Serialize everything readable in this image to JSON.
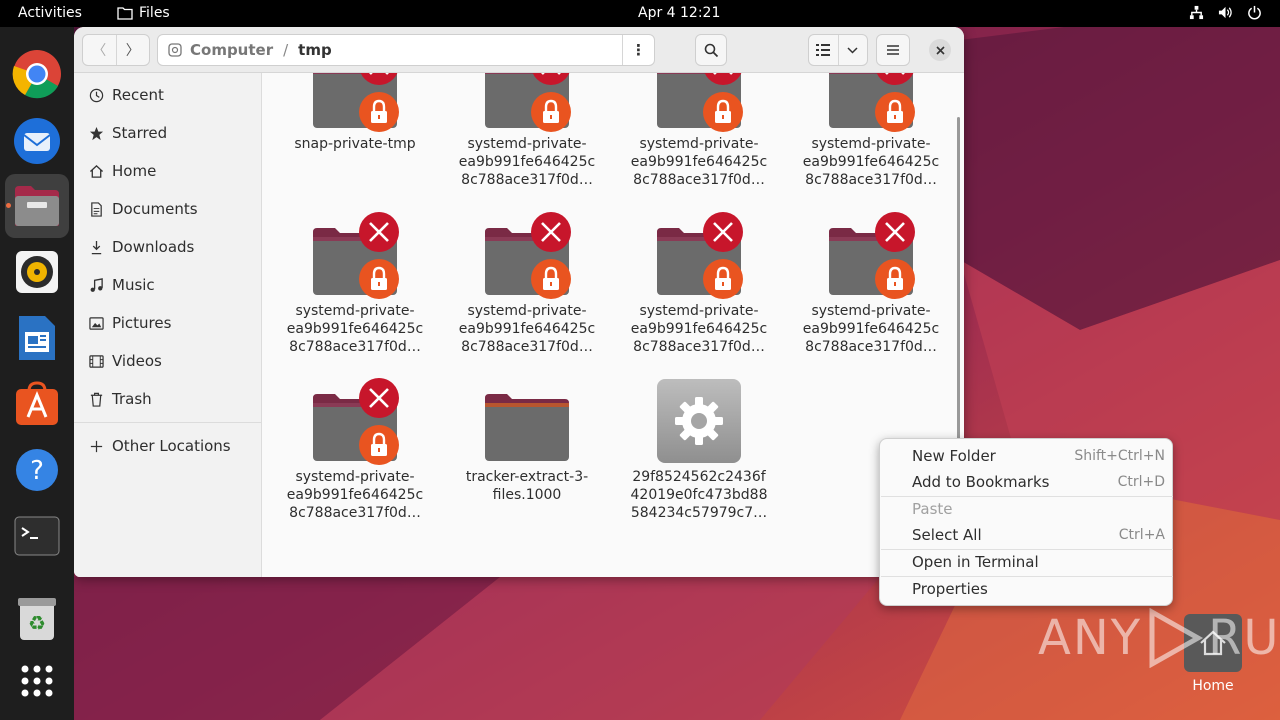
{
  "topbar": {
    "activities": "Activities",
    "app_name": "Files",
    "clock": "Apr 4  12:21"
  },
  "dock": {
    "items": [
      "chrome-icon",
      "thunderbird-icon",
      "files-icon",
      "rhythmbox-icon",
      "libreoffice-writer-icon",
      "app-center-icon",
      "help-icon",
      "terminal-icon",
      "trash-icon",
      "show-apps-icon"
    ]
  },
  "window": {
    "path": [
      "Computer",
      "tmp"
    ],
    "sidebar": [
      {
        "label": "Recent",
        "icon": "clock-icon"
      },
      {
        "label": "Starred",
        "icon": "star-icon"
      },
      {
        "label": "Home",
        "icon": "home-icon"
      },
      {
        "label": "Documents",
        "icon": "document-icon"
      },
      {
        "label": "Downloads",
        "icon": "download-icon"
      },
      {
        "label": "Music",
        "icon": "music-icon"
      },
      {
        "label": "Pictures",
        "icon": "picture-icon"
      },
      {
        "label": "Videos",
        "icon": "video-icon"
      },
      {
        "label": "Trash",
        "icon": "trash-icon"
      },
      {
        "label": "Other Locations",
        "icon": "plus-icon"
      }
    ],
    "files": [
      {
        "line1": "snap-private-tmp",
        "line2": "",
        "line3": "",
        "type": "locked-folder"
      },
      {
        "line1": "systemd-private-",
        "line2": "ea9b991fe646425c",
        "line3": "8c788ace317f0d…",
        "type": "locked-folder"
      },
      {
        "line1": "systemd-private-",
        "line2": "ea9b991fe646425c",
        "line3": "8c788ace317f0d…",
        "type": "locked-folder"
      },
      {
        "line1": "systemd-private-",
        "line2": "ea9b991fe646425c",
        "line3": "8c788ace317f0d…",
        "type": "locked-folder"
      },
      {
        "line1": "systemd-private-",
        "line2": "ea9b991fe646425c",
        "line3": "8c788ace317f0d…",
        "type": "locked-folder"
      },
      {
        "line1": "systemd-private-",
        "line2": "ea9b991fe646425c",
        "line3": "8c788ace317f0d…",
        "type": "locked-folder"
      },
      {
        "line1": "systemd-private-",
        "line2": "ea9b991fe646425c",
        "line3": "8c788ace317f0d…",
        "type": "locked-folder"
      },
      {
        "line1": "systemd-private-",
        "line2": "ea9b991fe646425c",
        "line3": "8c788ace317f0d…",
        "type": "locked-folder"
      },
      {
        "line1": "systemd-private-",
        "line2": "ea9b991fe646425c",
        "line3": "8c788ace317f0d…",
        "type": "locked-folder"
      },
      {
        "line1": "tracker-extract-3-",
        "line2": "files.1000",
        "line3": "",
        "type": "folder"
      },
      {
        "line1": "29f8524562c2436f",
        "line2": "42019e0fc473bd88",
        "line3": "584234c57979c7…",
        "type": "executable"
      }
    ]
  },
  "context_menu": {
    "items": [
      {
        "label": "New Folder",
        "shortcut": "Shift+Ctrl+N"
      },
      {
        "label": "Add to Bookmarks",
        "shortcut": "Ctrl+D"
      },
      {
        "label": "Paste",
        "shortcut": ""
      },
      {
        "label": "Select All",
        "shortcut": "Ctrl+A"
      },
      {
        "label": "Open in Terminal",
        "shortcut": ""
      },
      {
        "label": "Properties",
        "shortcut": ""
      }
    ]
  },
  "desktop": {
    "home_label": "Home",
    "watermark": {
      "left": "ANY",
      "right": "RUN"
    }
  },
  "colors": {
    "accent": "#e95420",
    "emblem_red": "#c7162b",
    "folder_dark": "#6b6b6b",
    "folder_tab": "#7a2a45"
  }
}
